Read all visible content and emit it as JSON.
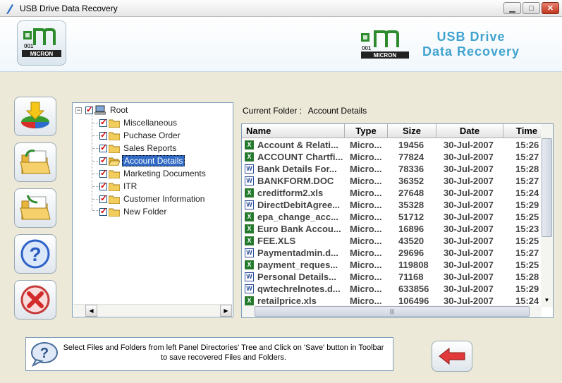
{
  "window": {
    "title": "USB Drive Data Recovery",
    "minimize": "▁",
    "maximize": "□",
    "close": "✕"
  },
  "header": {
    "logo_text": "MICRON",
    "product_line1": "USB Drive",
    "product_line2": "Data Recovery"
  },
  "toolbar": {
    "buttons": [
      "save-icon",
      "open-folder-icon",
      "save-folder-icon",
      "help-icon",
      "close-icon"
    ]
  },
  "tree": {
    "root": "Root",
    "items": [
      "Miscellaneous",
      "Puchase Order",
      "Sales Reports",
      "Account Details",
      "Marketing Documents",
      "ITR",
      "Customer Information",
      "New Folder"
    ],
    "selected_index": 3
  },
  "current_folder": {
    "label": "Current Folder :",
    "value": "Account Details"
  },
  "file_list": {
    "columns": [
      "Name",
      "Type",
      "Size",
      "Date",
      "Time"
    ],
    "rows": [
      {
        "icon": "xls",
        "name": "Account & Relati...",
        "type": "Micro...",
        "size": "19456",
        "date": "30-Jul-2007",
        "time": "15:26"
      },
      {
        "icon": "xls",
        "name": "ACCOUNT Chartfi...",
        "type": "Micro...",
        "size": "77824",
        "date": "30-Jul-2007",
        "time": "15:27"
      },
      {
        "icon": "doc",
        "name": "Bank Details For...",
        "type": "Micro...",
        "size": "78336",
        "date": "30-Jul-2007",
        "time": "15:28"
      },
      {
        "icon": "doc",
        "name": "BANKFORM.DOC",
        "type": "Micro...",
        "size": "36352",
        "date": "30-Jul-2007",
        "time": "15:27"
      },
      {
        "icon": "xls",
        "name": "creditform2.xls",
        "type": "Micro...",
        "size": "27648",
        "date": "30-Jul-2007",
        "time": "15:24"
      },
      {
        "icon": "doc",
        "name": "DirectDebitAgree...",
        "type": "Micro...",
        "size": "35328",
        "date": "30-Jul-2007",
        "time": "15:29"
      },
      {
        "icon": "xls",
        "name": "epa_change_acc...",
        "type": "Micro...",
        "size": "51712",
        "date": "30-Jul-2007",
        "time": "15:25"
      },
      {
        "icon": "xls",
        "name": "Euro Bank Accou...",
        "type": "Micro...",
        "size": "16896",
        "date": "30-Jul-2007",
        "time": "15:23"
      },
      {
        "icon": "xls",
        "name": "FEE.XLS",
        "type": "Micro...",
        "size": "43520",
        "date": "30-Jul-2007",
        "time": "15:25"
      },
      {
        "icon": "doc",
        "name": "Paymentadmin.d...",
        "type": "Micro...",
        "size": "29696",
        "date": "30-Jul-2007",
        "time": "15:27"
      },
      {
        "icon": "xls",
        "name": "payment_reques...",
        "type": "Micro...",
        "size": "119808",
        "date": "30-Jul-2007",
        "time": "15:25"
      },
      {
        "icon": "doc",
        "name": "Personal Details...",
        "type": "Micro...",
        "size": "71168",
        "date": "30-Jul-2007",
        "time": "15:28"
      },
      {
        "icon": "doc",
        "name": "qwtechrelnotes.d...",
        "type": "Micro...",
        "size": "633856",
        "date": "30-Jul-2007",
        "time": "15:29"
      },
      {
        "icon": "xls",
        "name": "retailprice.xls",
        "type": "Micro...",
        "size": "106496",
        "date": "30-Jul-2007",
        "time": "15:24"
      }
    ]
  },
  "status": {
    "message": "Select Files and Folders from left Panel Directories' Tree and Click on 'Save' button in Toolbar to save recovered Files and Folders."
  }
}
